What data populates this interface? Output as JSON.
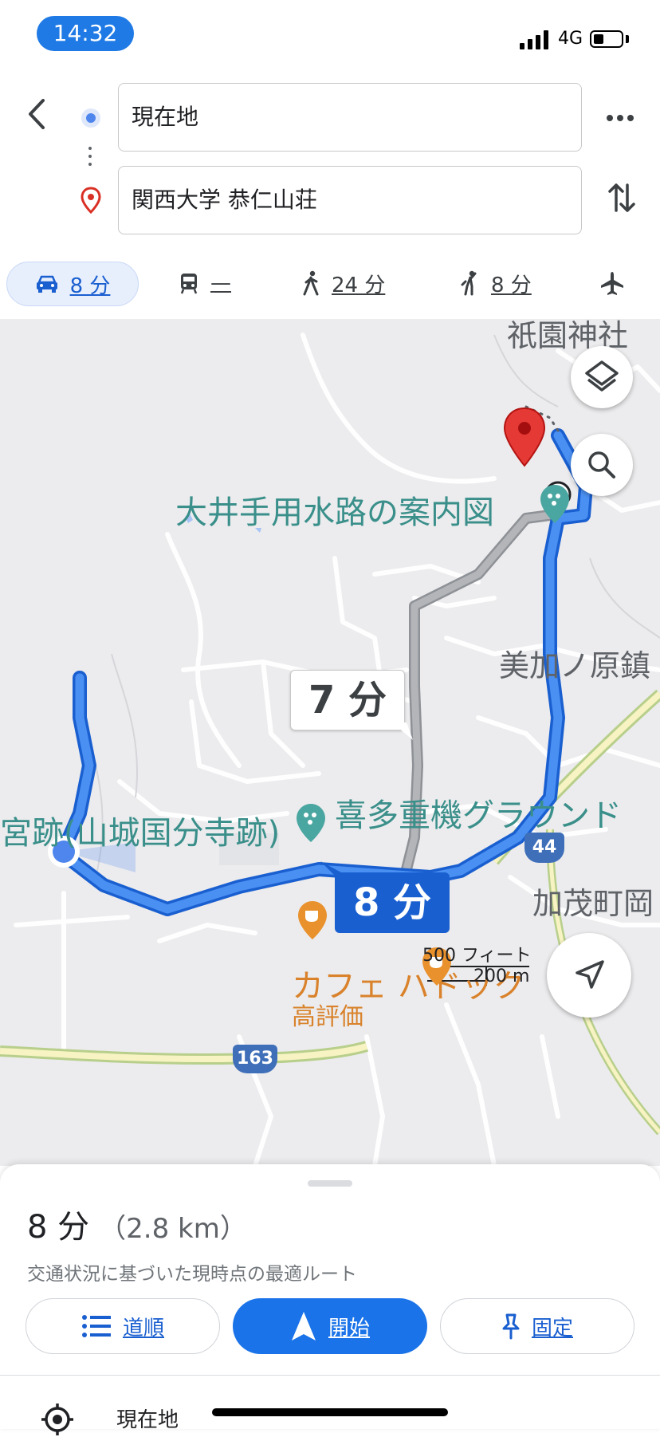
{
  "status": {
    "time": "14:32",
    "network": "4G"
  },
  "search": {
    "origin": "現在地",
    "destination": "関西大学 恭仁山荘"
  },
  "modes": [
    {
      "id": "drive",
      "label": "8 分",
      "selected": true
    },
    {
      "id": "transit",
      "label": "—",
      "selected": false
    },
    {
      "id": "walk",
      "label": "24 分",
      "selected": false
    },
    {
      "id": "ride",
      "label": "8 分",
      "selected": false
    },
    {
      "id": "flight",
      "label": "",
      "selected": false
    }
  ],
  "map": {
    "labels": {
      "shrine": "祇園神社",
      "guide_map": "大井手用水路の案内図",
      "minohara": "美加ノ原鎮",
      "temple": "宮跡(山城国分寺跡)",
      "ground": "喜多重機グラウンド",
      "kamo": "加茂町岡",
      "cafe": "カフェ ハドック",
      "cafe_rating": "高評価"
    },
    "route_alt_time": "7 分",
    "route_main_time": "8 分",
    "road_163": "163",
    "road_44": "44",
    "scale_ft": "500 フィート",
    "scale_m": "200 m",
    "colors": {
      "route": "#3d8ef0",
      "route_border": "#1a5fd0",
      "alt_route": "#a3a6aa",
      "pin": "#e53935",
      "teal": "#3a8f8a",
      "orange": "#d9822b"
    }
  },
  "sheet": {
    "time": "8 分",
    "distance": "（2.8 km）",
    "subtitle": "交通状況に基づいた現時点の最適ルート",
    "btn_steps": "道順",
    "btn_start": "開始",
    "btn_pin": "固定",
    "first_step": "現在地"
  }
}
